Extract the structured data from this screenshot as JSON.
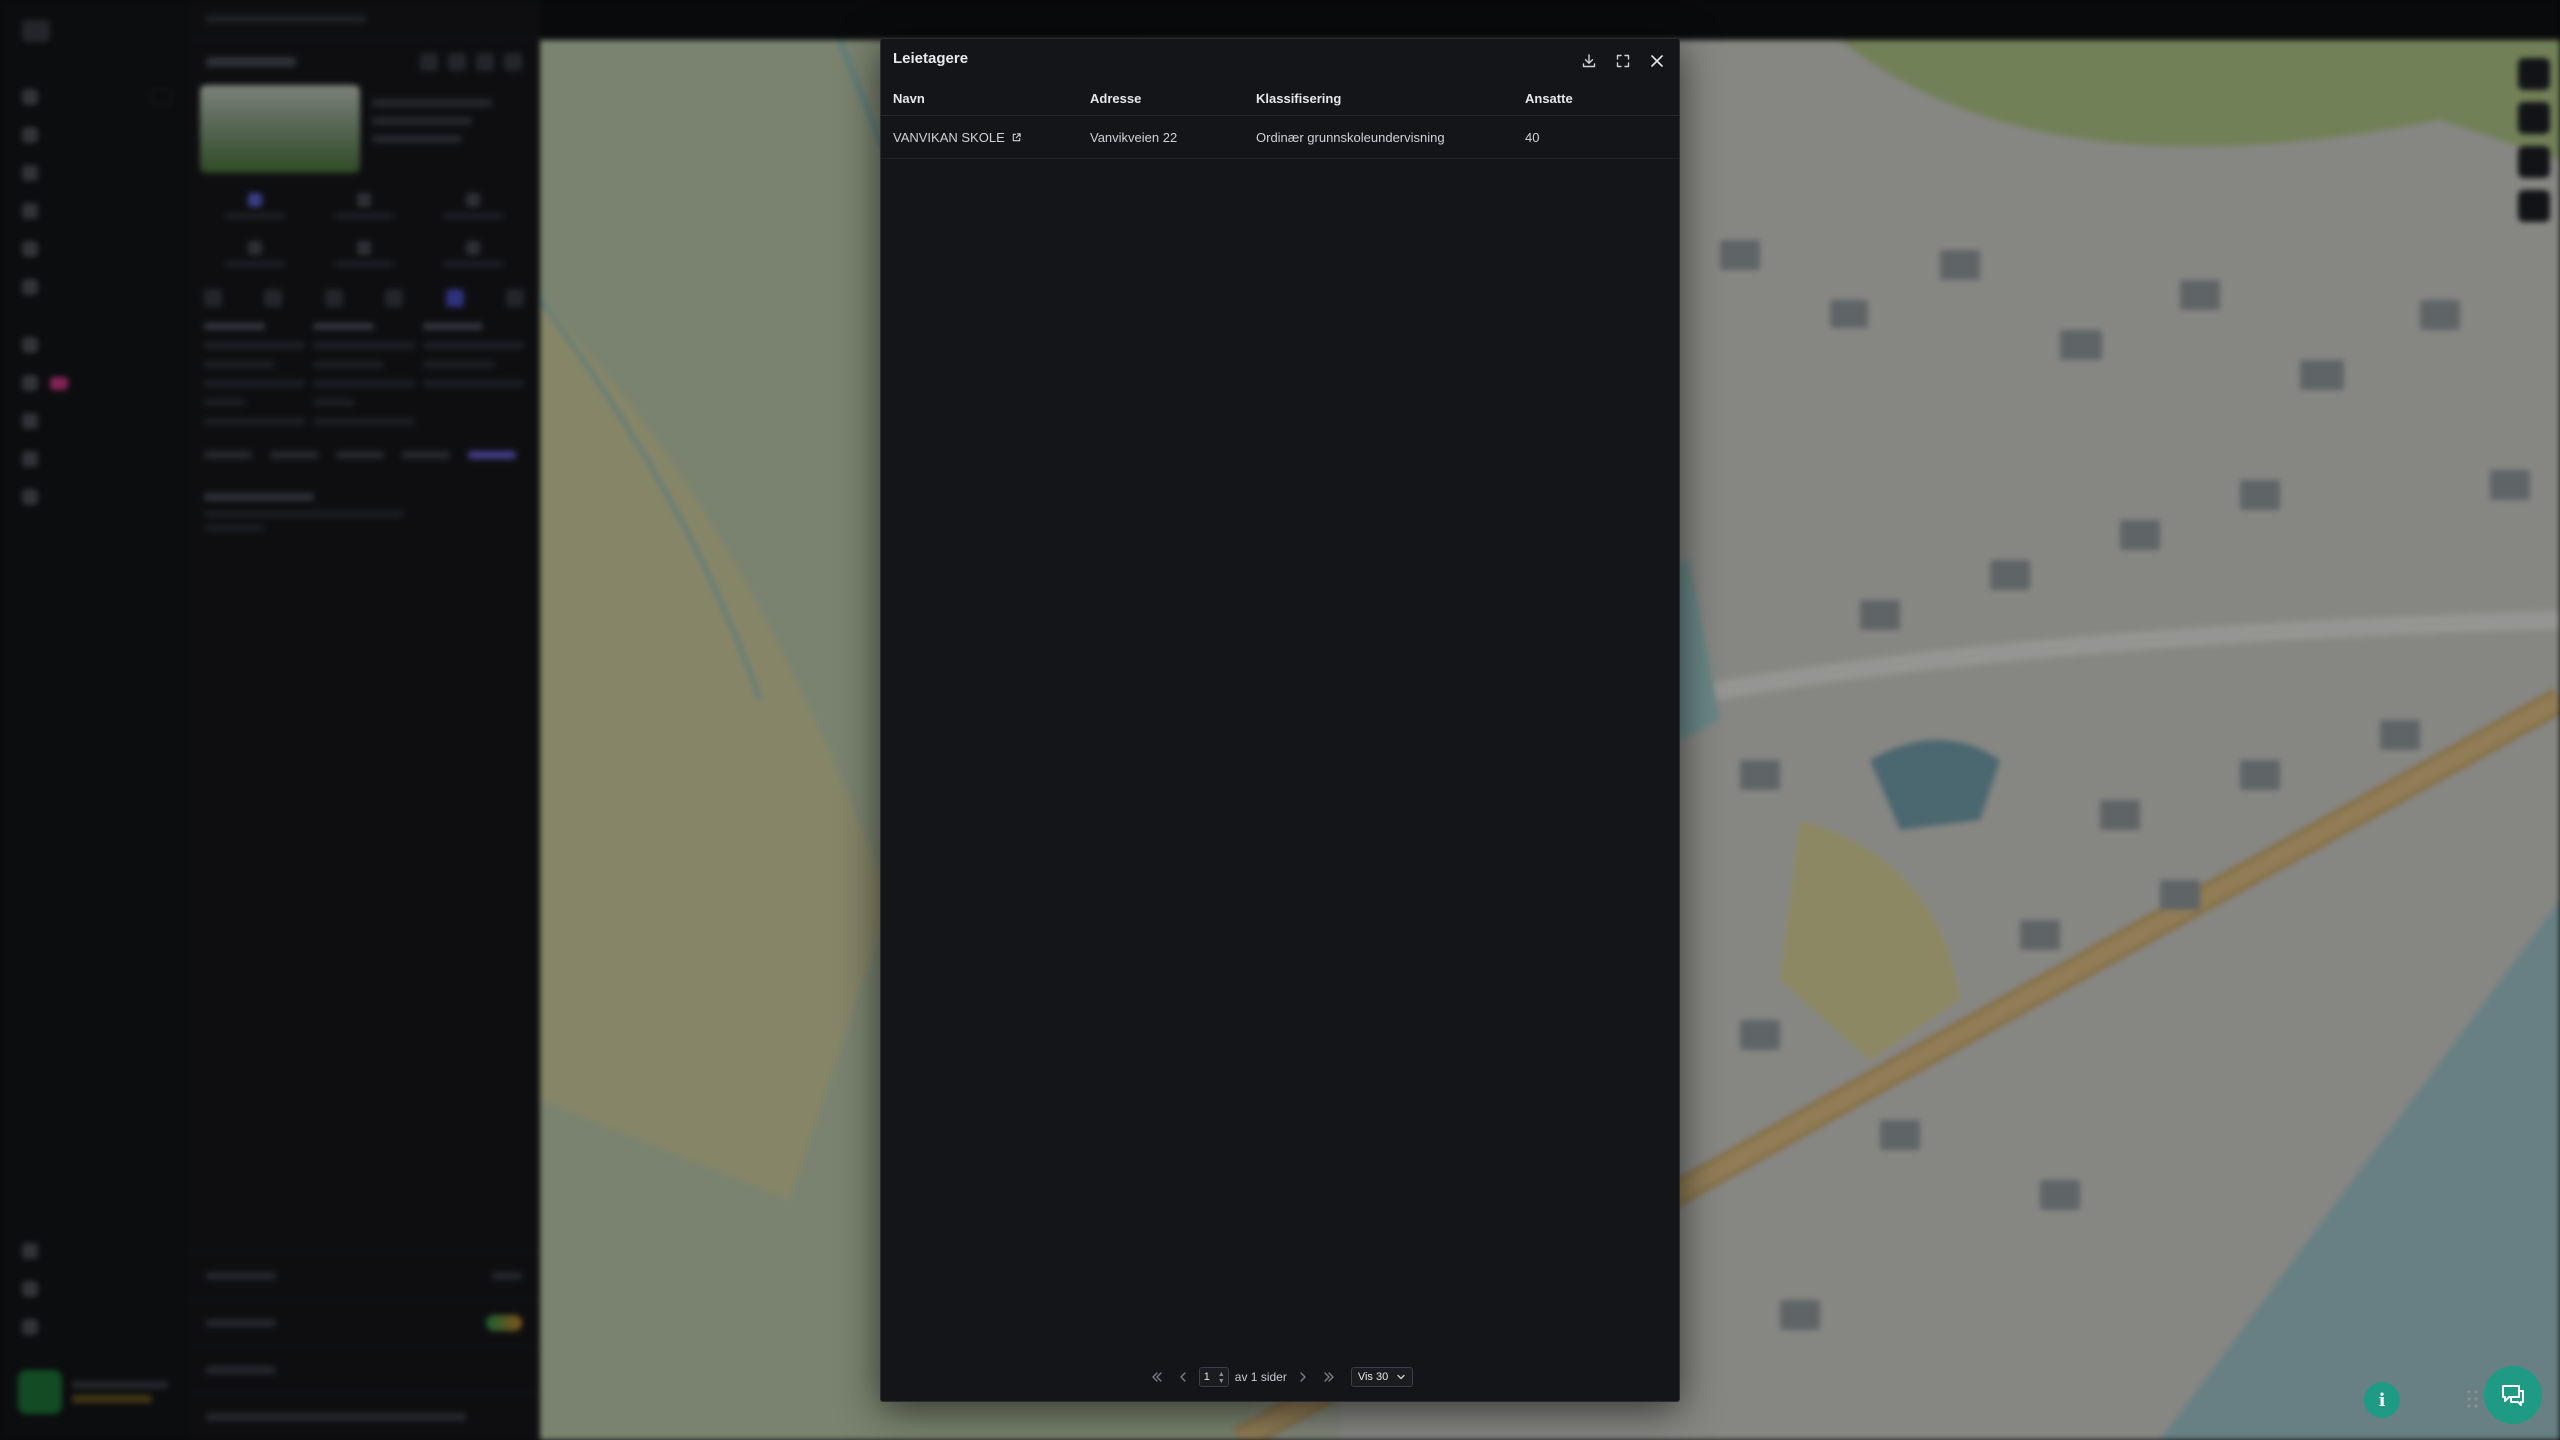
{
  "modal": {
    "title": "Leietagere",
    "columns": [
      "Navn",
      "Adresse",
      "Klassifisering",
      "Ansatte"
    ],
    "rows": [
      {
        "navn": "VANVIKAN SKOLE",
        "adresse": "Vanvikveien 22",
        "klassifisering": "Ordinær grunnskoleundervisning",
        "ansatte": "40"
      }
    ],
    "pagination": {
      "current_page": "1",
      "of_pages_label": "av 1 sider",
      "page_size_label": "Vis 30"
    },
    "icons": {
      "download": "download-icon",
      "fullscreen": "fullscreen-icon",
      "close": "close-icon",
      "external_link": "external-link-icon"
    }
  },
  "floating": {
    "info_icon_label": "i"
  },
  "colors": {
    "modal_bg": "#141518",
    "accent_teal": "#1f9a85",
    "text": "#e6e7ea"
  }
}
